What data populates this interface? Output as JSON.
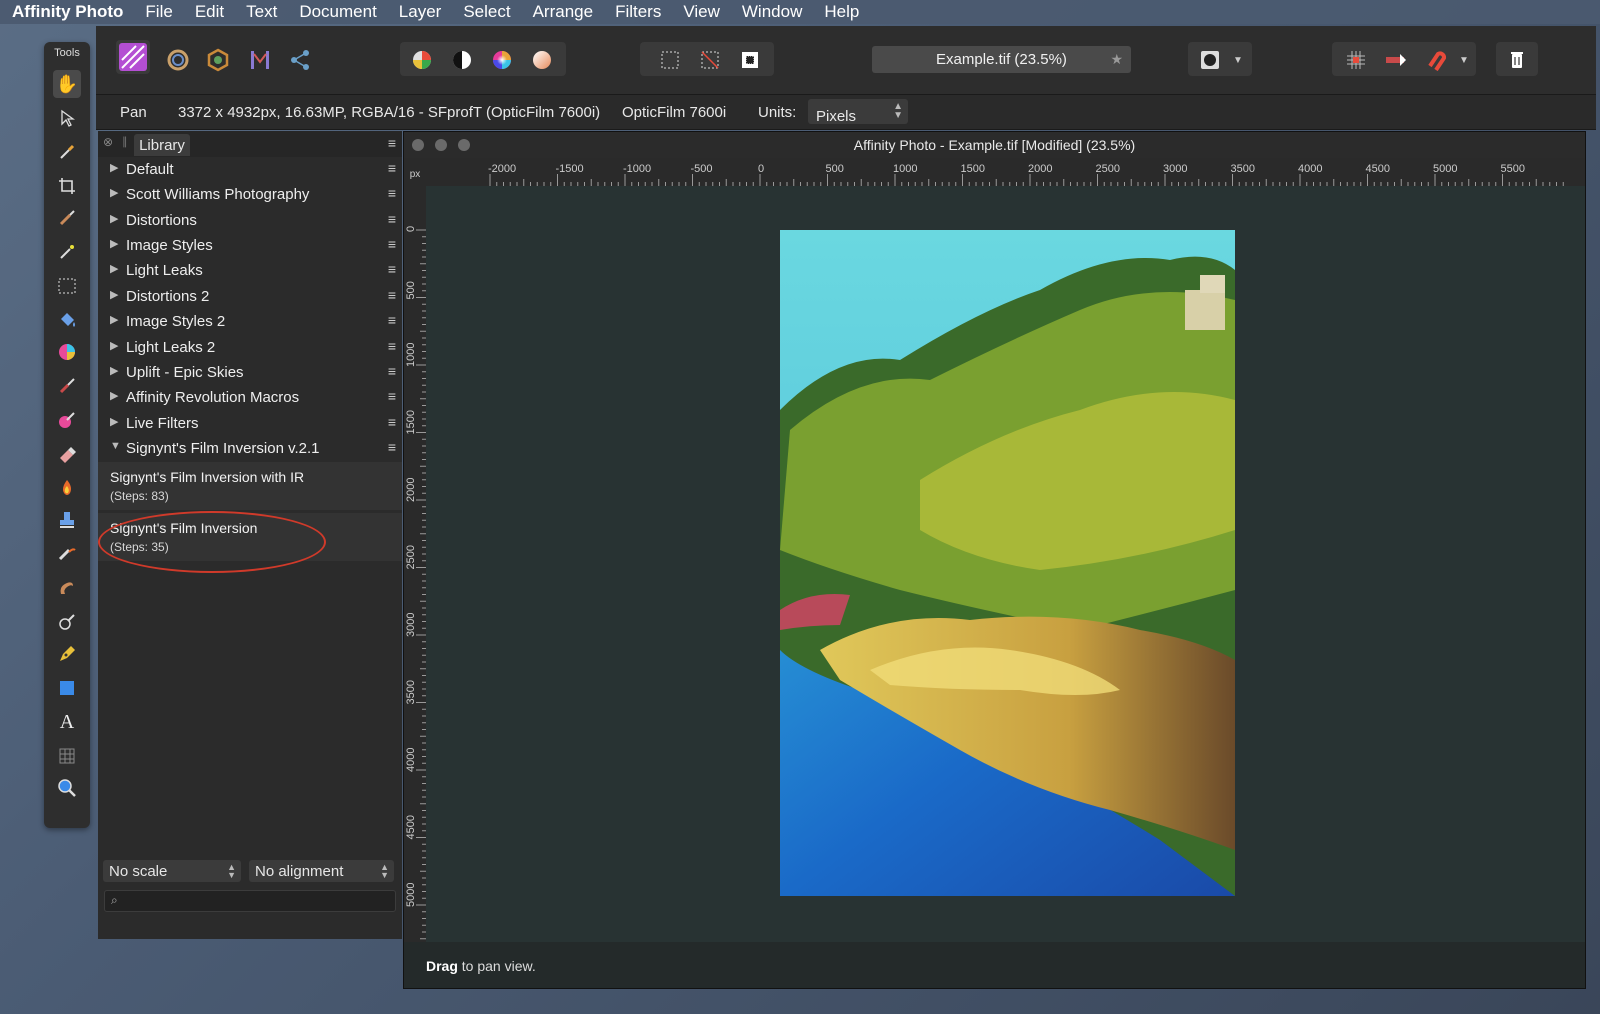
{
  "menubar": {
    "app": "Affinity Photo",
    "items": [
      "File",
      "Edit",
      "Text",
      "Document",
      "Layer",
      "Select",
      "Arrange",
      "Filters",
      "View",
      "Window",
      "Help"
    ]
  },
  "toolbar": {
    "personas": [
      "affinity-photo-persona-icon",
      "liquify-persona-icon",
      "develop-persona-icon",
      "tone-mapping-persona-icon",
      "export-persona-icon"
    ],
    "adjust": [
      "auto-levels-icon",
      "auto-contrast-icon",
      "auto-colour-icon",
      "auto-white-balance-icon"
    ],
    "selection_modes": [
      "marquee-select-icon",
      "deselect-icon",
      "invert-selection-icon"
    ],
    "document_title": "Example.tif (23.5%)",
    "right_icons": [
      "quick-mask-icon",
      "grid-icon",
      "snapping-toggle-icon",
      "snapping-magnet-icon",
      "trash-icon"
    ]
  },
  "contextbar": {
    "tool": "Pan",
    "info": "3372 x 4932px, 16.63MP, RGBA/16 - SFprofT (OpticFilm 7600i)",
    "device": "OpticFilm 7600i",
    "units_label": "Units:",
    "units_value": "Pixels"
  },
  "tools": {
    "header": "Tools",
    "items": [
      "hand-pan-icon",
      "move-pointer-icon",
      "color-picker-icon",
      "crop-icon",
      "selection-brush-icon",
      "flood-select-icon",
      "rectangular-marquee-icon",
      "flood-fill-icon",
      "gradient-icon",
      "paint-brush-icon",
      "color-replacement-icon",
      "erase-brush-icon",
      "dodge-burn-icon",
      "clone-stamp-icon",
      "healing-brush-icon",
      "smudge-icon",
      "blur-brush-icon",
      "pen-icon",
      "shape-rectangle-icon",
      "text-icon",
      "mesh-warp-icon",
      "zoom-icon"
    ]
  },
  "library": {
    "tab": "Library",
    "categories": [
      {
        "label": "Default",
        "open": false
      },
      {
        "label": "Scott Williams Photography",
        "open": false
      },
      {
        "label": "Distortions",
        "open": false
      },
      {
        "label": "Image Styles",
        "open": false
      },
      {
        "label": "Light Leaks",
        "open": false
      },
      {
        "label": "Distortions 2",
        "open": false
      },
      {
        "label": "Image Styles 2",
        "open": false
      },
      {
        "label": "Light Leaks 2",
        "open": false
      },
      {
        "label": "Uplift - Epic Skies",
        "open": false
      },
      {
        "label": "Affinity Revolution Macros",
        "open": false
      },
      {
        "label": "Live Filters",
        "open": false
      },
      {
        "label": "Signynt's Film Inversion v.2.1",
        "open": true
      }
    ],
    "macros": [
      {
        "name": "Signynt's Film Inversion with IR",
        "steps": "(Steps: 83)"
      },
      {
        "name": "Signynt's Film Inversion",
        "steps": "(Steps: 35)"
      }
    ],
    "scale": "No scale",
    "alignment": "No alignment",
    "search_placeholder": ""
  },
  "document": {
    "window_title": "Affinity Photo - Example.tif [Modified] (23.5%)",
    "ruler_unit": "px",
    "h_ticks": [
      "-2000",
      "-1500",
      "-1000",
      "-500",
      "0",
      "500",
      "1000",
      "1500",
      "2000",
      "2500",
      "3000",
      "3500",
      "4000",
      "4500",
      "5000",
      "5500"
    ],
    "v_ticks": [
      "0",
      "500",
      "1000",
      "1500",
      "2000",
      "2500",
      "3000",
      "3500",
      "4000",
      "4500",
      "5000"
    ],
    "status_bold": "Drag",
    "status_rest": " to pan view."
  },
  "colors": {
    "highlight": "#d03a2a",
    "panel_bg": "#2b2b2b",
    "canvas_bg": "#283333"
  }
}
